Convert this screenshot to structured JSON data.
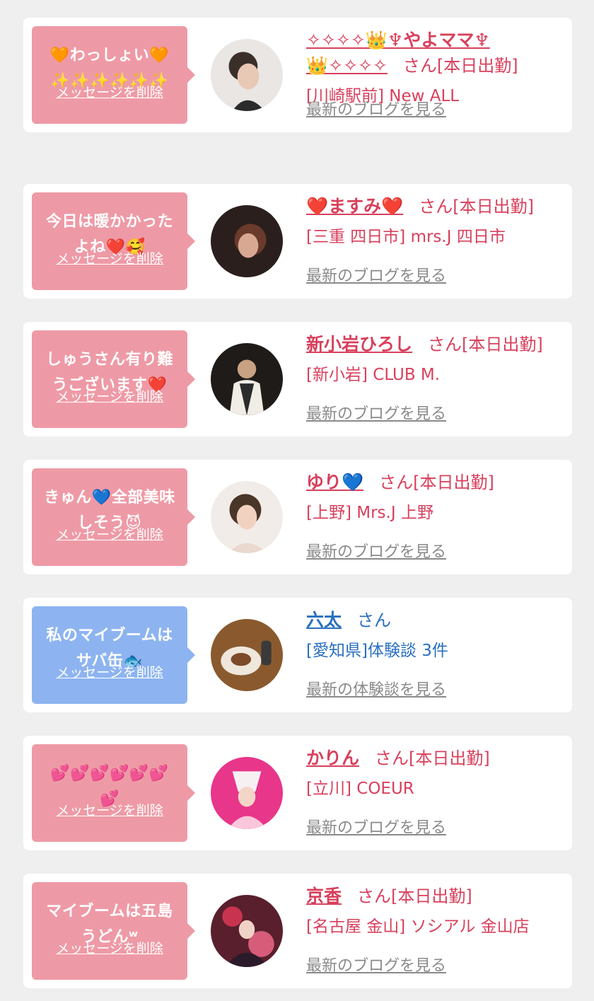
{
  "colors": {
    "pink_bubble": "#ee9aa6",
    "blue_bubble": "#8db4f0",
    "pink_text": "#d8405c",
    "blue_text": "#2a6fbf",
    "link_gray": "#8a8a8a"
  },
  "delete_label": "メッセージを削除",
  "entries": [
    {
      "message_line1": "🧡わっしょい🧡",
      "message_line2": "✨✨✨✨✨✨",
      "delete_label": "メッセージを削除",
      "name_line1": "✧✧✧✧👑♆やよママ♆",
      "name_line2": "👑✧✧✧✧",
      "suffix": "さん[本日出勤]",
      "shop": "[川崎駅前] New ALL",
      "blog_link": "最新のブログを見る",
      "avatar": "profile-photo-woman-updo"
    },
    {
      "message_line1": "今日は暖かかった",
      "message_line2": "よね❤️🥰",
      "delete_label": "メッセージを削除",
      "name": "❤️ますみ❤️",
      "suffix": "さん[本日出勤]",
      "shop": "[三重 四日市] mrs.J 四日市",
      "blog_link": "最新のブログを見る",
      "avatar": "profile-photo-woman-dark"
    },
    {
      "message_line1": "しゅうさん有り難",
      "message_line2": "うございます❤️",
      "delete_label": "メッセージを削除",
      "name": "新小岩ひろし",
      "suffix": "さん[本日出勤]",
      "shop": "[新小岩] CLUB M.",
      "blog_link": "最新のブログを見る",
      "avatar": "profile-photo-man-suit"
    },
    {
      "message_line1": "きゅん💙全部美味",
      "message_line2": "しそう😈",
      "delete_label": "メッセージを削除",
      "name": "ゆり💙",
      "suffix": "さん[本日出勤]",
      "shop": "[上野] Mrs.J 上野",
      "blog_link": "最新のブログを見る",
      "avatar": "profile-photo-woman-smile"
    },
    {
      "message_line1": "私のマイブームは",
      "message_line2": "サバ缶🐟",
      "delete_label": "メッセージを削除",
      "name": "六太",
      "suffix": "さん",
      "shop": "[愛知県]体験談 3件",
      "blog_link": "最新の体験談を見る",
      "avatar": "profile-photo-food"
    },
    {
      "message_line1": "💕💕💕💕💕💕",
      "message_line2": "💕",
      "delete_label": "メッセージを削除",
      "name": "かりん",
      "suffix": "さん[本日出勤]",
      "shop": "[立川] COEUR",
      "blog_link": "最新のブログを見る",
      "avatar": "profile-photo-woman-fan"
    },
    {
      "message_line1": "マイブームは五島",
      "message_line2": "うどんʷ",
      "delete_label": "メッセージを削除",
      "name": "京香",
      "suffix": "さん[本日出勤]",
      "shop": "[名古屋 金山] ソシアル 金山店",
      "blog_link": "最新のブログを見る",
      "avatar": "profile-photo-kimono"
    }
  ]
}
